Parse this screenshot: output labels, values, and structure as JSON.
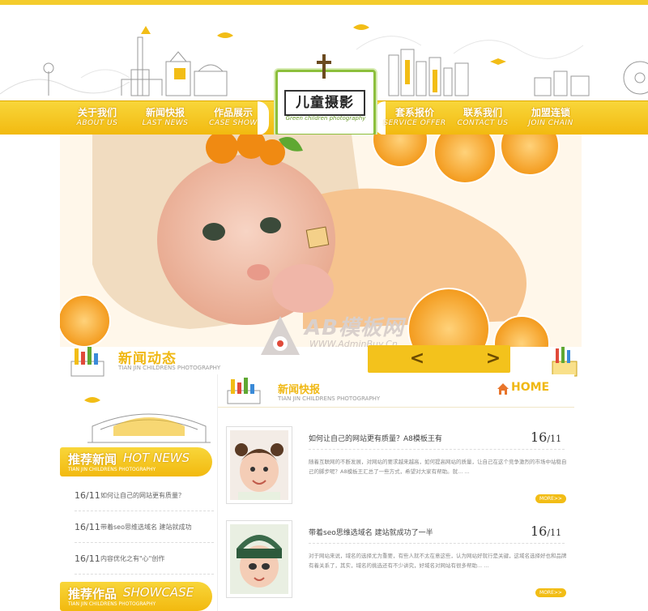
{
  "colors": {
    "accent": "#f3c21c",
    "accent_dark": "#e0a800",
    "green": "#8cbf3c"
  },
  "logo": {
    "title": "儿童摄影",
    "subtitle": "Green children photography"
  },
  "nav": {
    "left": [
      {
        "cn": "关于我们",
        "en": "ABOUT US"
      },
      {
        "cn": "新闻快报",
        "en": "LAST NEWS"
      },
      {
        "cn": "作品展示",
        "en": "CASE SHOW"
      }
    ],
    "right": [
      {
        "cn": "套系报价",
        "en": "SERVICE OFFER"
      },
      {
        "cn": "联系我们",
        "en": "CONTACT US"
      },
      {
        "cn": "加盟连锁",
        "en": "JOIN CHAIN"
      }
    ]
  },
  "watermark": {
    "text": "AB模板网",
    "sub": "WWW.AdminBuy.Cn"
  },
  "news_section": {
    "title": "新闻动态",
    "subtitle": "TIAN JIN CHILDRENS PHOTOGRAPHY",
    "prev": "<",
    "next": ">"
  },
  "hot_news": {
    "title_cn": "推荐新闻",
    "title_en": "HOT NEWS",
    "subtitle": "TIAN JIN CHILDRENS PHOTOGRAPHY",
    "items": [
      {
        "date": "16/11",
        "text": "如何让自己的网站更有质量？"
      },
      {
        "date": "16/11",
        "text": "带着seo思维选域名 建站就成功"
      },
      {
        "date": "16/11",
        "text": "内容优化之有\"心\"创作"
      }
    ]
  },
  "showcase": {
    "title_cn": "推荐作品",
    "title_en": "SHOWCASE",
    "subtitle": "TIAN JIN CHILDRENS PHOTOGRAPHY"
  },
  "news_flash": {
    "title": "新闻快报",
    "subtitle": "TIAN JIN CHILDRENS PHOTOGRAPHY",
    "home": "HOME",
    "items": [
      {
        "title": "如何让自己的网站更有质量？A8模板王有",
        "day": "16",
        "month": "/11",
        "body": "随着互联网的不断发展，对网站的要求越来越高，如何提高网站的质量，让自己在这个竞争激烈的市场中站稳自己的脚步呢？A8模板王汇总了一些方式，希望对大家有帮助。就... ...",
        "more": "MORE>>"
      },
      {
        "title": "带着seo思维选域名 建站就成功了一半",
        "day": "16",
        "month": "/11",
        "body": "对于网站来说，域名的选择尤为重要，有些人就不太在意这些，认为网站好就行是关键，这域名选择好也和品牌有着关系了，其实，域名的挑选还有不少讲究，好域名对网站有很多帮助... ...",
        "more": "MORE>>"
      }
    ]
  }
}
